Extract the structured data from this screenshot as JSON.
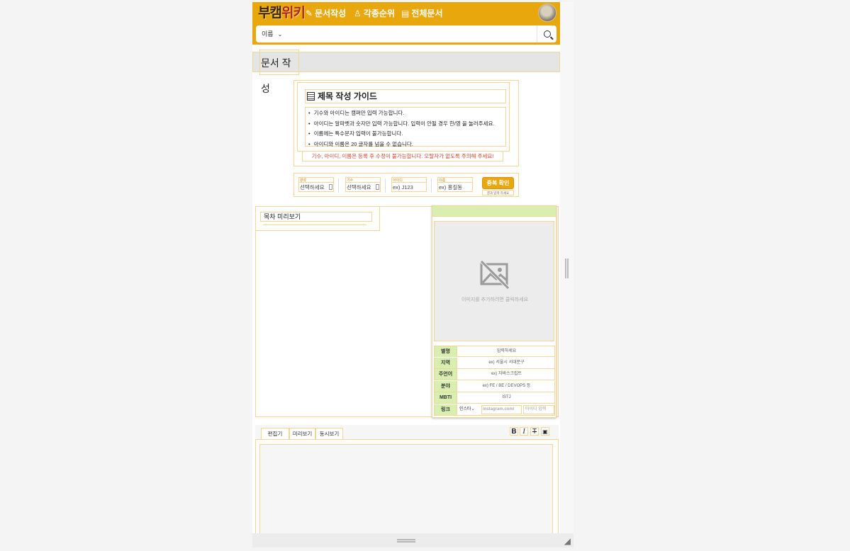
{
  "header": {
    "logo": {
      "part1": "부캠",
      "part2": "위키"
    },
    "nav": [
      {
        "icon": "✎",
        "label": "문서작성"
      },
      {
        "icon": "♙",
        "label": "각종순위"
      },
      {
        "icon": "▤",
        "label": "전체문서"
      }
    ],
    "search": {
      "select_value": "이름",
      "placeholder": ""
    }
  },
  "page": {
    "title": "문서 작성"
  },
  "guide": {
    "title": "제목 작성 가이드",
    "items": [
      "기수와 아이디는 캠퍼만 입력 가능합니다.",
      "아이디는 알파벳과 숫자만 입력 가능합니다. 입력이 안될 경우 한/영 을 눌러주세요.",
      "이름에는 특수문자 입력이 불가능합니다.",
      "아이디와 이름은 20 글자를 넘을 수 없습니다."
    ],
    "warning": "기수, 아이디, 이름은 등록 후 수정이 불가능합니다. 오탈자가 없도록 주의해 주세요!"
  },
  "dup_check": {
    "fields": [
      {
        "label": "분류",
        "value": "선택하세요"
      },
      {
        "label": "기수",
        "value": "선택하세요"
      },
      {
        "label": "아이디",
        "value": "ex) J123"
      },
      {
        "label": "이름",
        "value": "ex) 홍길동"
      }
    ],
    "button": "중복 확인",
    "note": "결과 입력 하세요"
  },
  "toc": {
    "title": "목차 미리보기"
  },
  "info_card": {
    "image_placeholder": "이미지를 추가하려면 클릭하세요",
    "rows": [
      {
        "key": "별명",
        "value": "입력하세요"
      },
      {
        "key": "지역",
        "value": "ex) 서울시 서대문구"
      },
      {
        "key": "주언어",
        "value": "ex) 자바스크립트"
      },
      {
        "key": "분야",
        "value": "ex) FE / BE / DEVOPS 등"
      },
      {
        "key": "MBTI",
        "value": "ISTJ"
      }
    ],
    "link": {
      "key": "링크",
      "select": "인스타",
      "url_placeholder": "instagram.com/",
      "id_placeholder": "아이디 입력"
    }
  },
  "editor": {
    "tabs": [
      "편집기",
      "미리보기",
      "동시보기"
    ],
    "toolbar": {
      "bold": "B",
      "italic": "I",
      "strike": "T"
    }
  },
  "colors": {
    "brand": "#e8a70c",
    "accent_green": "#d9efb1",
    "warning_red": "#d9442c",
    "outline": "#f1d795"
  }
}
